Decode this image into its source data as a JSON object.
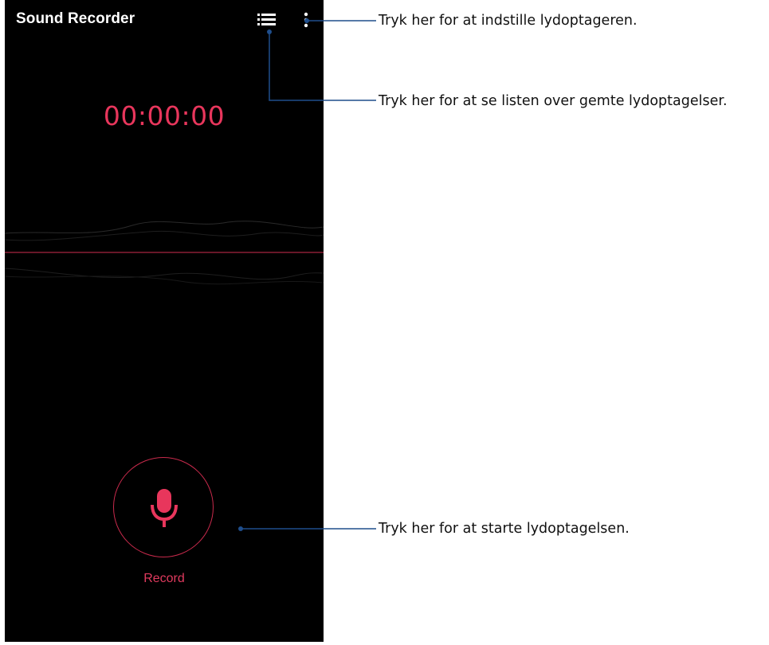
{
  "app": {
    "title": "Sound Recorder"
  },
  "toolbar": {
    "list_icon": "list-icon",
    "more_icon": "more-vert-icon"
  },
  "timer": {
    "value": "00:00:00"
  },
  "record": {
    "label": "Record",
    "icon": "microphone-icon"
  },
  "colors": {
    "accent": "#e8365c",
    "background": "#000000",
    "callout_line": "#1f4e8c"
  },
  "callouts": [
    {
      "text": "Tryk her for at indstille lydoptageren."
    },
    {
      "text": "Tryk her for at se listen over gemte lydoptagelser."
    },
    {
      "text": "Tryk her for at starte lydoptagelsen."
    }
  ]
}
